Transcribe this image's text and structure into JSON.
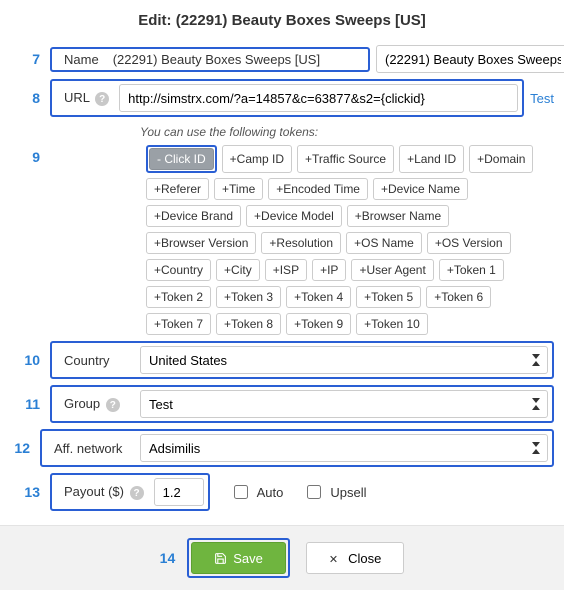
{
  "title": "Edit: (22291) Beauty Boxes Sweeps [US]",
  "annot": {
    "n7": "7",
    "n8": "8",
    "n9": "9",
    "n10": "10",
    "n11": "11",
    "n12": "12",
    "n13": "13",
    "n14": "14"
  },
  "name": {
    "label": "Name",
    "value": "(22291) Beauty Boxes Sweeps [US]"
  },
  "url": {
    "label": "URL",
    "value": "http://simstrx.com/?a=14857&c=63877&s2={clickid}",
    "test": "Test"
  },
  "tokens": {
    "hint": "You can use the following tokens:",
    "items": [
      "- Click ID",
      "+Camp ID",
      "+Traffic Source",
      "+Land ID",
      "+Domain",
      "+Referer",
      "+Time",
      "+Encoded Time",
      "+Device Name",
      "+Device Brand",
      "+Device Model",
      "+Browser Name",
      "+Browser Version",
      "+Resolution",
      "+OS Name",
      "+OS Version",
      "+Country",
      "+City",
      "+ISP",
      "+IP",
      "+User Agent",
      "+Token 1",
      "+Token 2",
      "+Token 3",
      "+Token 4",
      "+Token 5",
      "+Token 6",
      "+Token 7",
      "+Token 8",
      "+Token 9",
      "+Token 10"
    ]
  },
  "country": {
    "label": "Country",
    "value": "United States"
  },
  "group": {
    "label": "Group",
    "value": "Test"
  },
  "network": {
    "label": "Aff. network",
    "value": "Adsimilis"
  },
  "payout": {
    "label": "Payout ($)",
    "value": "1.2",
    "auto": "Auto",
    "upsell": "Upsell"
  },
  "buttons": {
    "save": "Save",
    "close": "Close"
  }
}
